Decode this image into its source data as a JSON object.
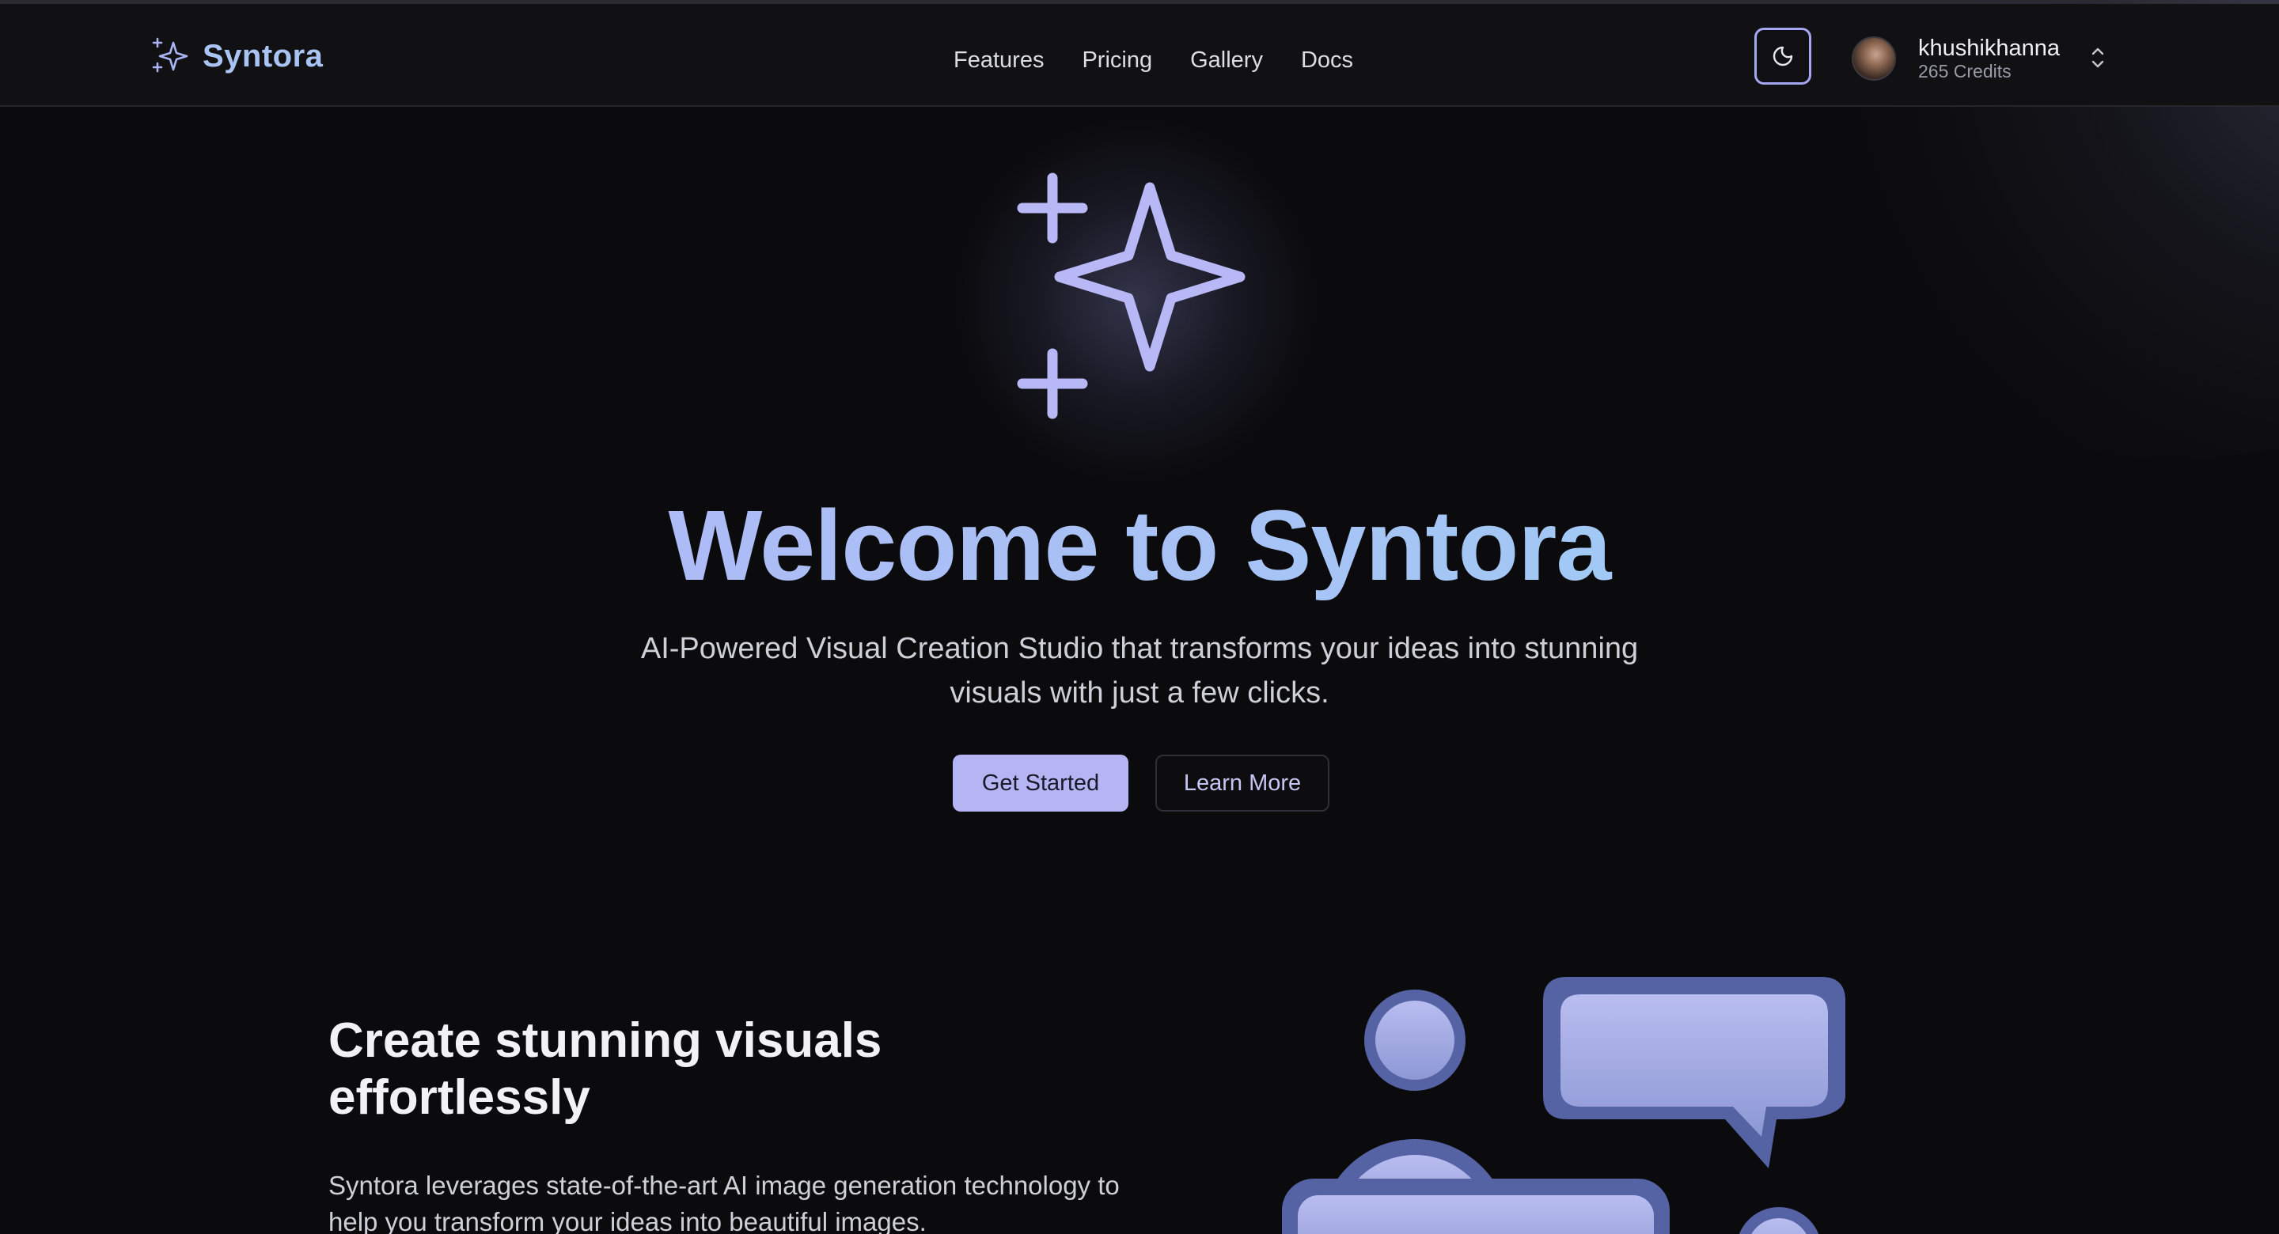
{
  "brand": {
    "name": "Syntora",
    "icon": "sparkles-icon",
    "color": "#a9c4f2"
  },
  "nav": {
    "links": [
      "Features",
      "Pricing",
      "Gallery",
      "Docs"
    ]
  },
  "theme_toggle": {
    "icon": "moon-icon"
  },
  "user": {
    "name": "khushikhanna",
    "credits": "265 Credits",
    "menu_icon": "chevron-up-down-icon"
  },
  "hero": {
    "icon": "sparkles-icon",
    "title": "Welcome to Syntora",
    "subtitle": "AI-Powered Visual Creation Studio that transforms your ideas into stunning visuals with just a few clicks.",
    "primary_button": "Get Started",
    "secondary_button": "Learn More",
    "accent": "#b5b5f3"
  },
  "feature": {
    "title": "Create stunning visuals effortlessly",
    "body": "Syntora leverages state-of-the-art AI image generation technology to help you transform your ideas into beautiful images.",
    "illustration": "chat-users-illustration"
  }
}
